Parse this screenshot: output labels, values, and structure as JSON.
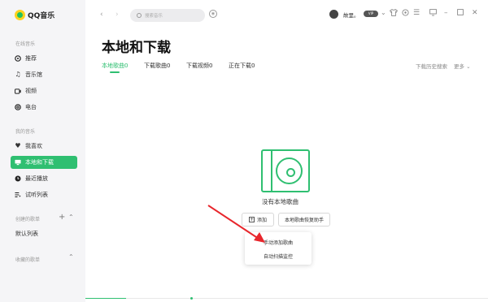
{
  "app": {
    "name": "QQ音乐"
  },
  "sidebar": {
    "online_title": "在线音乐",
    "online_items": [
      {
        "label": "推荐",
        "icon": "recommend-icon"
      },
      {
        "label": "音乐馆",
        "icon": "music-note-icon"
      },
      {
        "label": "视频",
        "icon": "video-icon"
      },
      {
        "label": "电台",
        "icon": "radio-icon"
      }
    ],
    "my_title": "我的音乐",
    "my_items": [
      {
        "label": "我喜欢",
        "icon": "heart-icon"
      },
      {
        "label": "本地和下载",
        "icon": "monitor-icon",
        "active": true
      },
      {
        "label": "最近播放",
        "icon": "clock-icon"
      },
      {
        "label": "试听列表",
        "icon": "list-icon"
      }
    ],
    "created_title": "创建的歌单",
    "created_items": [
      "默认列表"
    ],
    "collected_title": "收藏的歌单"
  },
  "topbar": {
    "search_placeholder": "搜索音乐",
    "username": "故里。",
    "vip_label": "VIP"
  },
  "main": {
    "title": "本地和下载",
    "tabs": [
      {
        "label": "本地歌曲0",
        "active": true
      },
      {
        "label": "下载歌曲0"
      },
      {
        "label": "下载视频0"
      },
      {
        "label": "正在下载0"
      }
    ],
    "history_link": "下载历史搜索",
    "more_link": "更多",
    "empty_text": "没有本地歌曲",
    "add_button": "添加",
    "restore_button": "本地歌曲恢复助手",
    "dropdown": [
      "手动添加歌曲",
      "自动扫描监控"
    ]
  },
  "colors": {
    "accent": "#2fbf71",
    "arrow": "#e8262c"
  },
  "player": {
    "progress": 0.1
  }
}
